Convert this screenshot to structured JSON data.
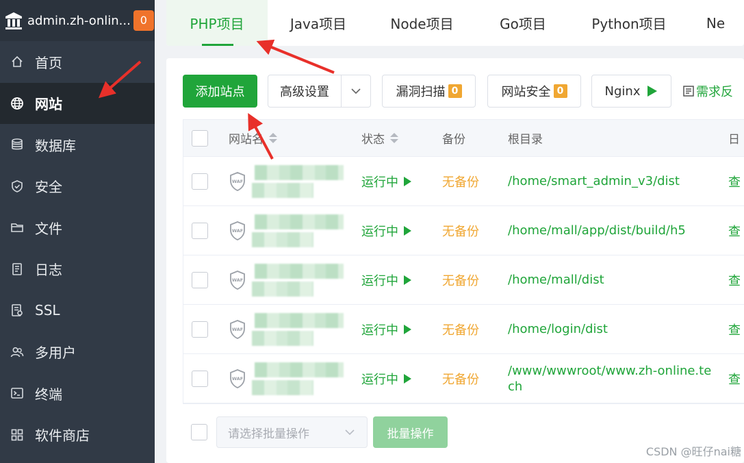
{
  "sidebar": {
    "title": "admin.zh-onlin...",
    "badge": "0",
    "items": [
      {
        "label": "首页",
        "icon": "home-icon"
      },
      {
        "label": "网站",
        "icon": "globe-icon",
        "active": true
      },
      {
        "label": "数据库",
        "icon": "database-icon"
      },
      {
        "label": "安全",
        "icon": "shield-icon"
      },
      {
        "label": "文件",
        "icon": "folder-icon"
      },
      {
        "label": "日志",
        "icon": "log-icon"
      },
      {
        "label": "SSL",
        "icon": "ssl-icon"
      },
      {
        "label": "多用户",
        "icon": "users-icon"
      },
      {
        "label": "终端",
        "icon": "terminal-icon"
      },
      {
        "label": "软件商店",
        "icon": "store-icon"
      }
    ]
  },
  "tabs": [
    {
      "label": "PHP项目",
      "active": true
    },
    {
      "label": "Java项目"
    },
    {
      "label": "Node项目"
    },
    {
      "label": "Go项目"
    },
    {
      "label": "Python项目"
    },
    {
      "label": "Ne"
    }
  ],
  "toolbar": {
    "add_site": "添加站点",
    "advanced": "高级设置",
    "vuln_scan": "漏洞扫描",
    "vuln_count": "0",
    "site_security": "网站安全",
    "security_count": "0",
    "nginx": "Nginx",
    "demand": "需求反"
  },
  "table": {
    "headers": {
      "name": "网站名",
      "status": "状态",
      "backup": "备份",
      "root": "根目录",
      "extra": "日"
    },
    "rows": [
      {
        "status": "运行中",
        "backup": "无备份",
        "root": "/home/smart_admin_v3/dist",
        "extra": "查"
      },
      {
        "status": "运行中",
        "backup": "无备份",
        "root": "/home/mall/app/dist/build/h5",
        "extra": "查"
      },
      {
        "status": "运行中",
        "backup": "无备份",
        "root": "/home/mall/dist",
        "extra": "查"
      },
      {
        "status": "运行中",
        "backup": "无备份",
        "root": "/home/login/dist",
        "extra": "查"
      },
      {
        "status": "运行中",
        "backup": "无备份",
        "root": "/www/wwwroot/www.zh-online.tech",
        "extra": "查"
      }
    ]
  },
  "footer": {
    "batch_placeholder": "请选择批量操作",
    "batch_button": "批量操作"
  },
  "watermark": "CSDN @旺仔nai糖",
  "colors": {
    "sidebar_bg": "#313a46",
    "accent": "#20a53a",
    "warning": "#f0a732",
    "arrow": "#e8302a"
  }
}
